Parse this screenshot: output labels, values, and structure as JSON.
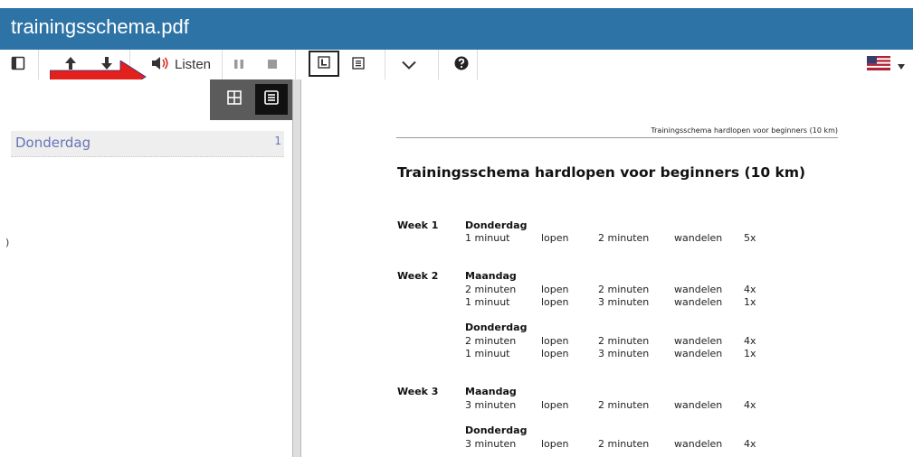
{
  "window": {
    "title": "trainingsschema.pdf"
  },
  "toolbar": {
    "listen_label": "Listen",
    "icons": [
      "sidebar-toggle-icon",
      "up-arrow-icon",
      "down-arrow-icon",
      "speaker-icon",
      "pause-icon",
      "stop-icon",
      "single-page-icon",
      "text-view-icon",
      "chevron-down-icon",
      "help-icon",
      "us-flag-icon",
      "dropdown-triangle-icon"
    ]
  },
  "colors": {
    "titlebar": "#2e73a6",
    "annotation_arrow": "#e3201b",
    "outline_text": "#6673b8"
  },
  "sidebar": {
    "outline": [
      {
        "label": "Donderdag",
        "page": "1"
      }
    ],
    "stray_char": ")"
  },
  "document": {
    "header": "Trainingsschema hardlopen voor beginners (10 km)",
    "title": "Trainingsschema hardlopen voor beginners (10 km)",
    "weeks": [
      {
        "label": "Week 1",
        "days": [
          {
            "name": "Donderdag",
            "rows": [
              {
                "d1": "1 minuut",
                "a1": "lopen",
                "d2": "2 minuten",
                "a2": "wandelen",
                "rep": "5x"
              }
            ]
          }
        ]
      },
      {
        "label": "Week 2",
        "days": [
          {
            "name": "Maandag",
            "rows": [
              {
                "d1": "2 minuten",
                "a1": "lopen",
                "d2": "2 minuten",
                "a2": "wandelen",
                "rep": "4x"
              },
              {
                "d1": "1 minuut",
                "a1": "lopen",
                "d2": "3 minuten",
                "a2": "wandelen",
                "rep": "1x"
              }
            ]
          },
          {
            "name": "Donderdag",
            "rows": [
              {
                "d1": "2 minuten",
                "a1": "lopen",
                "d2": "2 minuten",
                "a2": "wandelen",
                "rep": "4x"
              },
              {
                "d1": "1 minuut",
                "a1": "lopen",
                "d2": "3 minuten",
                "a2": "wandelen",
                "rep": "1x"
              }
            ]
          }
        ]
      },
      {
        "label": "Week 3",
        "days": [
          {
            "name": "Maandag",
            "rows": [
              {
                "d1": "3 minuten",
                "a1": "lopen",
                "d2": "2 minuten",
                "a2": "wandelen",
                "rep": "4x"
              }
            ]
          },
          {
            "name": "Donderdag",
            "rows": [
              {
                "d1": "3 minuten",
                "a1": "lopen",
                "d2": "2 minuten",
                "a2": "wandelen",
                "rep": "4x"
              }
            ]
          }
        ]
      }
    ]
  }
}
